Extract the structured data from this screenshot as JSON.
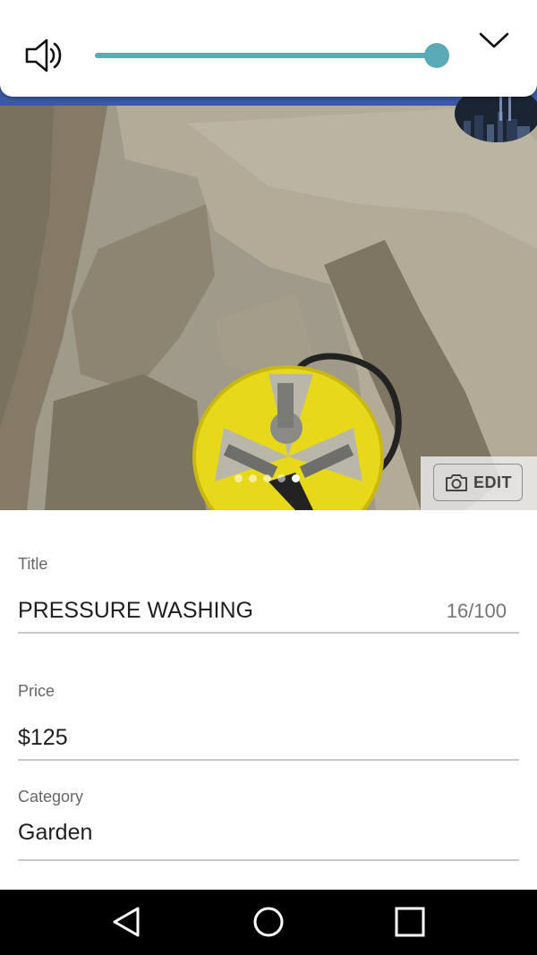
{
  "volume": {
    "level": 0.995,
    "icon": "speaker-icon",
    "collapse_icon": "chevron-down-icon",
    "track_color": "#dfeeee",
    "accent_color": "#5aaab7"
  },
  "gallery": {
    "image_count": 5,
    "active_index": 4,
    "edit_label": "EDIT",
    "edit_icon": "camera-icon"
  },
  "form": {
    "title": {
      "label": "Title",
      "value": "PRESSURE WASHING",
      "counter": "16/100"
    },
    "price": {
      "label": "Price",
      "value": "$125"
    },
    "category": {
      "label": "Category",
      "value": "Garden"
    }
  },
  "navbar": {
    "back_icon": "back-triangle-icon",
    "home_icon": "home-circle-icon",
    "recents_icon": "recents-square-icon"
  }
}
